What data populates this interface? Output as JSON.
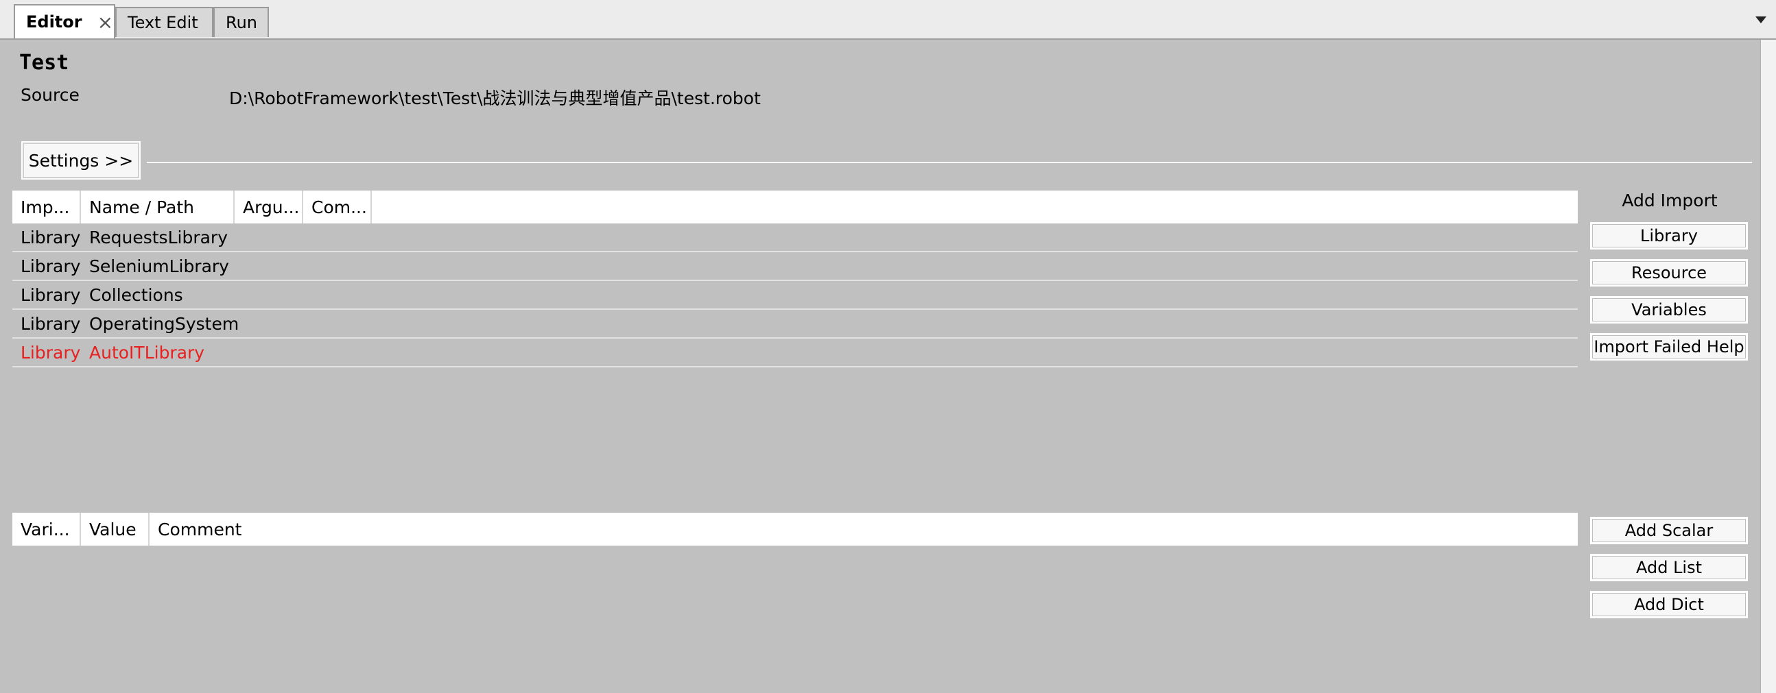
{
  "tabs": [
    {
      "label": "Editor",
      "close": "×"
    },
    {
      "label": "Text Edit"
    },
    {
      "label": "Run"
    }
  ],
  "header": {
    "title": "Test",
    "source_label": "Source",
    "source_value": "D:\\RobotFramework\\test\\Test\\战法训法与典型增值产品\\test.robot"
  },
  "settings_button": "Settings >>",
  "imports": {
    "columns": [
      "Imp...",
      "Name / Path",
      "Argu...",
      "Com..."
    ],
    "rows": [
      {
        "type": "Library",
        "name": "RequestsLibrary",
        "failed": false
      },
      {
        "type": "Library",
        "name": "SeleniumLibrary",
        "failed": false
      },
      {
        "type": "Library",
        "name": "Collections",
        "failed": false
      },
      {
        "type": "Library",
        "name": "OperatingSystem",
        "failed": false
      },
      {
        "type": "Library",
        "name": "AutoITLibrary",
        "failed": true
      }
    ],
    "failed_color": "#e8201f"
  },
  "add_import": {
    "label": "Add Import",
    "buttons": [
      "Library",
      "Resource",
      "Variables",
      "Import Failed Help"
    ]
  },
  "variables": {
    "columns": [
      "Vari...",
      "Value",
      "Comment"
    ]
  },
  "add_variable_buttons": [
    "Add Scalar",
    "Add List",
    "Add Dict"
  ]
}
